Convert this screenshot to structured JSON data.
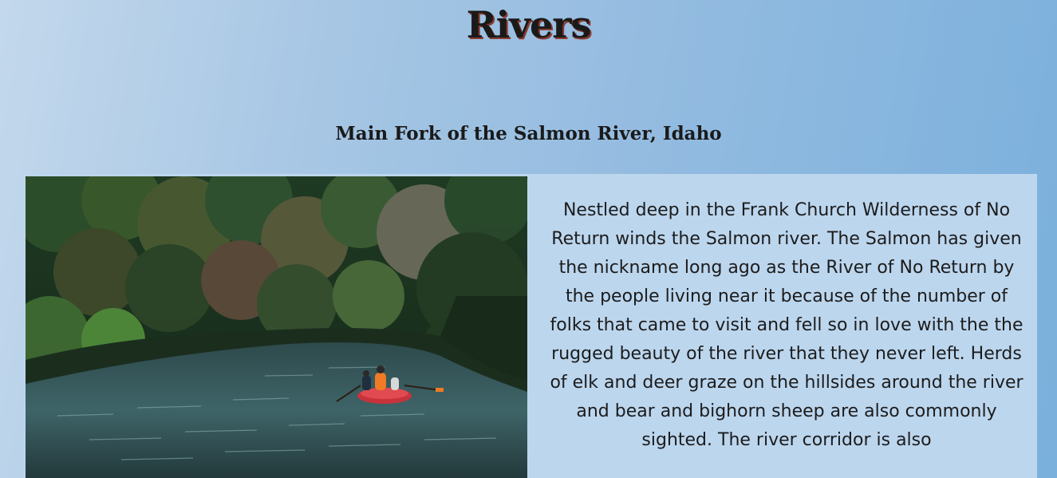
{
  "page": {
    "title": "Rivers"
  },
  "rivers": [
    {
      "name": "Main Fork of the Salmon River, Idaho",
      "image_icon": "river-rafting-photo",
      "description": "Nestled deep in the Frank Church Wilderness of No Return winds the Salmon river. The Salmon has given the nickname long ago as the River of No Return by the people living near it because of the number of folks that came to visit and fell so in love with the the rugged beauty of the river that they never left. Herds of elk and deer graze on the hillsides around the river and bear and bighorn sheep are also commonly sighted. The river corridor is also"
    }
  ],
  "colors": {
    "background_start": "#c3d8ec",
    "background_end": "#7ab0dc",
    "card": "#bcd6ee",
    "title_shadow": "#8a3b2e",
    "text": "#1a1a1a"
  }
}
